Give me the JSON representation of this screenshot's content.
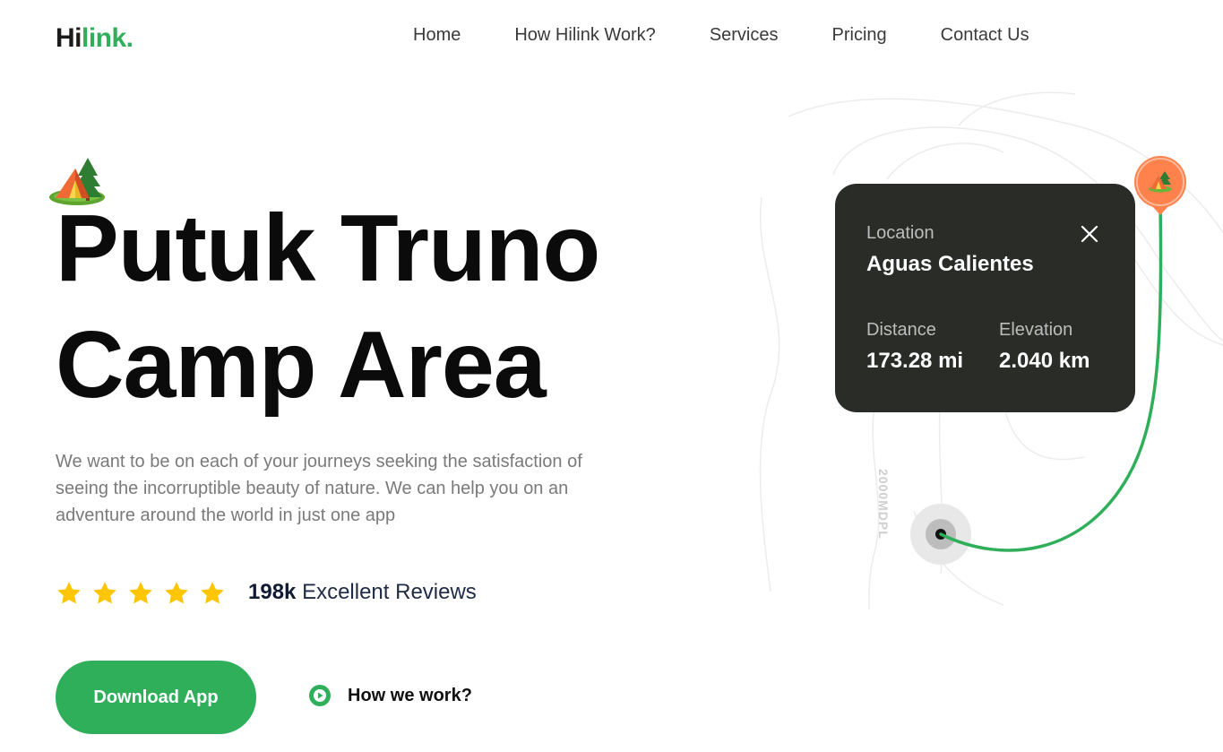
{
  "brand": {
    "logo_main": "Hi",
    "logo_accent": "link."
  },
  "nav": {
    "items": [
      {
        "label": "Home"
      },
      {
        "label": "How Hilink Work?"
      },
      {
        "label": "Services"
      },
      {
        "label": "Pricing"
      },
      {
        "label": "Contact Us"
      }
    ]
  },
  "hero": {
    "title_line1": "Putuk Truno",
    "title_line2": "Camp Area",
    "description": "We want to be on each of your journeys seeking the satisfaction of seeing the incorruptible beauty of nature. We can help you on an adventure around the world in just one app",
    "rating_stars": 5,
    "reviews_count": "198k",
    "reviews_text": "Excellent Reviews",
    "download_label": "Download App",
    "how_label": "How we work?"
  },
  "map": {
    "card": {
      "location_label": "Location",
      "location_value": "Aguas Calientes",
      "distance_label": "Distance",
      "distance_value": "173.28 mi",
      "elevation_label": "Elevation",
      "elevation_value": "2.040 km"
    },
    "elevation_mark": "2000MDPL"
  },
  "colors": {
    "accent": "#30af5b",
    "card_bg": "#292c27",
    "star": "#fec601",
    "pin": "#ff814c"
  },
  "icons": {
    "camp": "camp-icon",
    "star": "star-icon",
    "play": "play-icon",
    "close": "close-icon"
  }
}
